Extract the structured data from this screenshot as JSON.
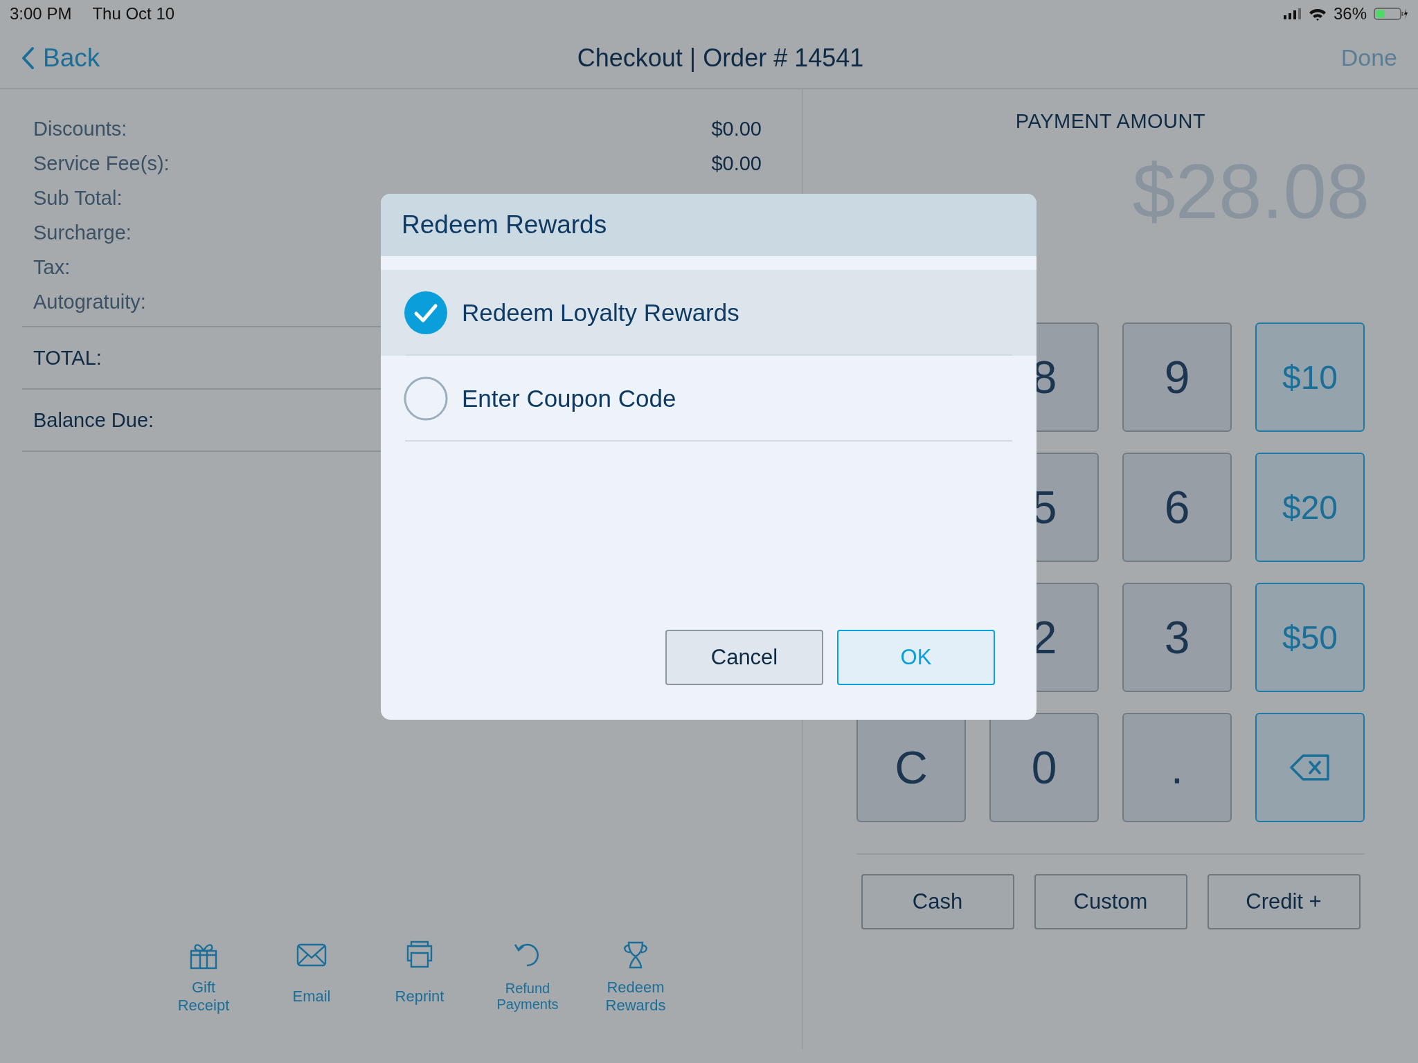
{
  "status_bar": {
    "time": "3:00 PM",
    "date": "Thu Oct 10",
    "battery": "36%"
  },
  "nav": {
    "back": "Back",
    "title": "Checkout | Order # 14541",
    "done": "Done",
    "done_disabled": true
  },
  "summary": {
    "rows": [
      {
        "label": "Discounts:",
        "value": "$0.00"
      },
      {
        "label": "Service Fee(s):",
        "value": "$0.00"
      },
      {
        "label": "Sub Total:"
      },
      {
        "label": "Surcharge:"
      },
      {
        "label": "Tax:"
      },
      {
        "label": "Autogratuity:"
      }
    ],
    "total": "TOTAL:",
    "balance": "Balance Due:"
  },
  "actions": [
    {
      "label": "Gift Receipt",
      "kind": "gift"
    },
    {
      "label": "Email",
      "kind": "email"
    },
    {
      "label": "Reprint",
      "kind": "print"
    },
    {
      "label": "Refund Payments",
      "kind": "refund"
    },
    {
      "label": "Redeem Rewards",
      "kind": "trophy"
    }
  ],
  "payment": {
    "heading": "PAYMENT AMOUNT",
    "amount": "$28.08"
  },
  "keypad": [
    [
      {
        "label": "8",
        "kind": "digit"
      },
      {
        "label": "9",
        "kind": "digit"
      },
      {
        "label": "$10",
        "kind": "amount"
      }
    ],
    [
      {
        "label": "5",
        "kind": "digit"
      },
      {
        "label": "6",
        "kind": "digit"
      },
      {
        "label": "$20",
        "kind": "amount"
      }
    ],
    [
      {
        "label": "2",
        "kind": "digit"
      },
      {
        "label": "3",
        "kind": "digit"
      },
      {
        "label": "$50",
        "kind": "amount"
      }
    ],
    [
      {
        "label": "C",
        "kind": "digit"
      },
      {
        "label": "0",
        "kind": "digit"
      },
      {
        "label": ".",
        "kind": "digit"
      },
      {
        "kind": "backspace"
      }
    ]
  ],
  "tenders": [
    "Cash",
    "Custom",
    "Credit +"
  ],
  "dialog": {
    "title": "Redeem Rewards",
    "options": [
      {
        "label": "Redeem Loyalty Rewards",
        "selected": true
      },
      {
        "label": "Enter Coupon Code",
        "selected": false
      }
    ],
    "buttons": [
      {
        "label": "Cancel",
        "kind": "secondary"
      },
      {
        "label": "OK",
        "kind": "primary"
      }
    ]
  }
}
